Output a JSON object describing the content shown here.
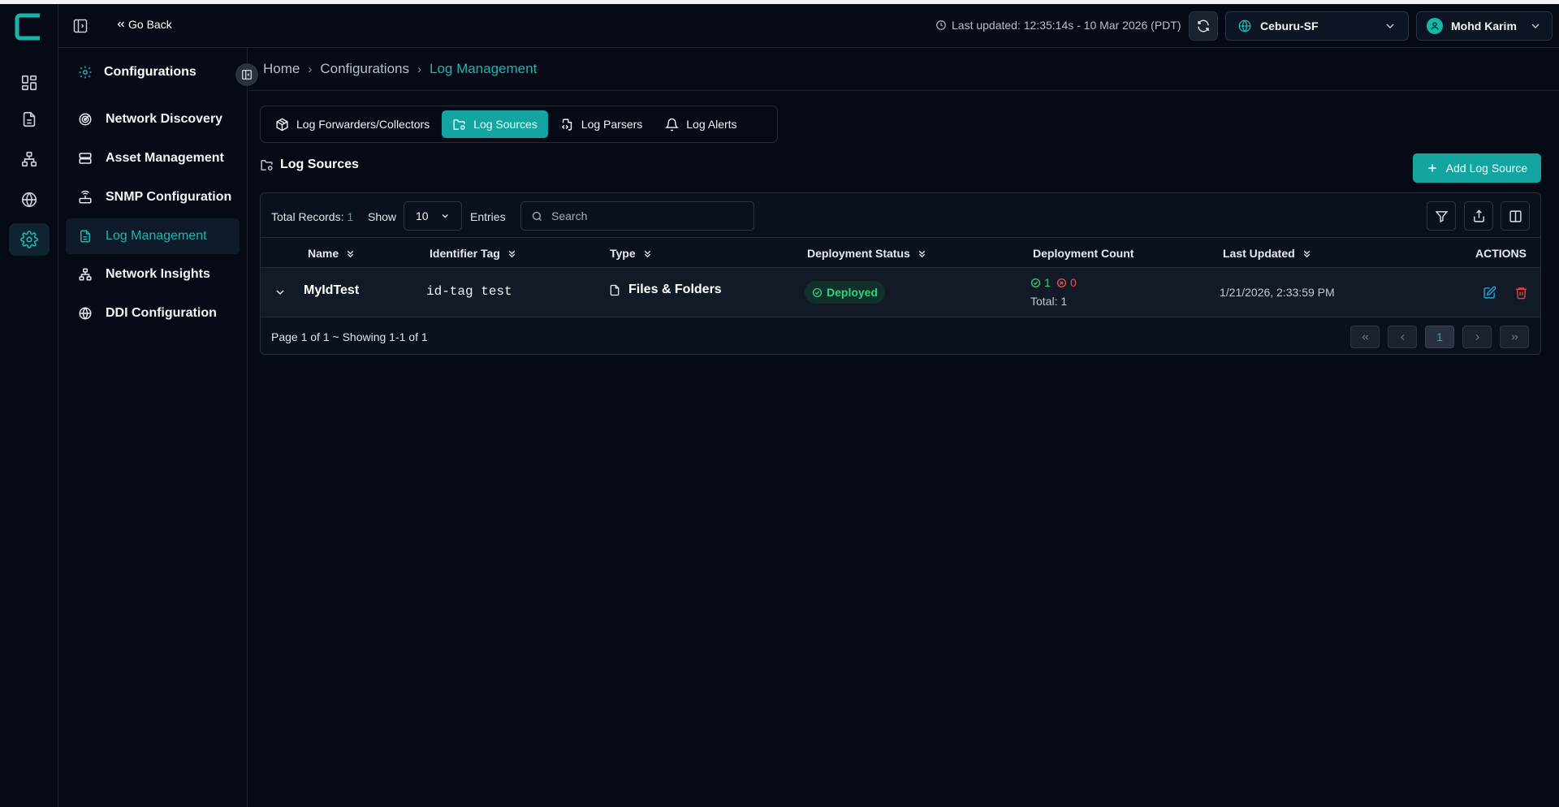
{
  "header": {
    "go_back_label": "Go Back",
    "last_updated": "Last updated: 12:35:14s - 10 Mar 2026 (PDT)",
    "site": "Ceburu-SF",
    "user": "Mohd Karim"
  },
  "rail": {
    "items": [
      "dashboard",
      "reports",
      "topology",
      "network",
      "settings"
    ]
  },
  "config_sidebar": {
    "title": "Configurations",
    "items": [
      {
        "label": "Network Discovery"
      },
      {
        "label": "Asset Management"
      },
      {
        "label": "SNMP Configuration"
      },
      {
        "label": "Log Management",
        "active": true
      },
      {
        "label": "Network Insights"
      },
      {
        "label": "DDI Configuration"
      }
    ]
  },
  "breadcrumb": {
    "items": [
      "Home",
      "Configurations",
      "Log Management"
    ],
    "separator": "›"
  },
  "tabs": [
    {
      "label": "Log Forwarders/Collectors"
    },
    {
      "label": "Log Sources",
      "active": true
    },
    {
      "label": "Log Parsers"
    },
    {
      "label": "Log Alerts"
    }
  ],
  "section": {
    "title": "Log Sources",
    "add_button": "Add Log Source"
  },
  "toolbar": {
    "total_label": "Total Records:",
    "total_value": "1",
    "show_label": "Show",
    "page_size": "10",
    "entries_label": "Entries",
    "search_placeholder": "Search"
  },
  "table": {
    "columns": [
      "Name",
      "Identifier Tag",
      "Type",
      "Deployment Status",
      "Deployment Count",
      "Last Updated",
      "ACTIONS"
    ],
    "rows": [
      {
        "name": "MyIdTest",
        "identifier_tag": "id-tag test",
        "type": "Files & Folders",
        "status": "Deployed",
        "count_success": "1",
        "count_failed": "0",
        "count_total": "Total: 1",
        "last_updated": "1/21/2026, 2:33:59 PM"
      }
    ]
  },
  "pagination": {
    "info": "Page 1 of 1 ~ Showing 1-1 of 1",
    "current_page": "1"
  },
  "colors": {
    "accent": "#14a5a0",
    "accent_text": "#1fb5ae",
    "success": "#34d17e",
    "danger": "#f05252",
    "background": "#050a16"
  }
}
